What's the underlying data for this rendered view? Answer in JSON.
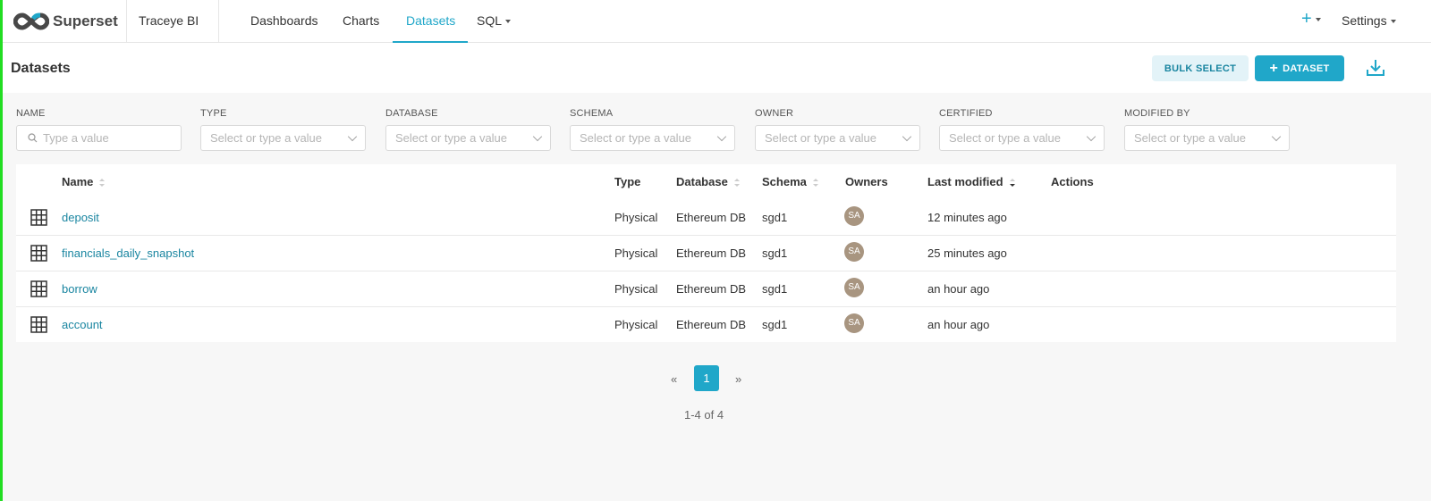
{
  "nav": {
    "logo_text": "Superset",
    "brand": "Traceye BI",
    "items": [
      "Dashboards",
      "Charts",
      "Datasets",
      "SQL"
    ],
    "plus": "+",
    "settings": "Settings"
  },
  "header": {
    "title": "Datasets",
    "bulk_select": "BULK SELECT",
    "add_dataset": "DATASET",
    "add_icon": "+"
  },
  "filters": {
    "name": {
      "label": "NAME",
      "placeholder": "Type a value"
    },
    "type": {
      "label": "TYPE",
      "placeholder": "Select or type a value"
    },
    "database": {
      "label": "DATABASE",
      "placeholder": "Select or type a value"
    },
    "schema": {
      "label": "SCHEMA",
      "placeholder": "Select or type a value"
    },
    "owner": {
      "label": "OWNER",
      "placeholder": "Select or type a value"
    },
    "certified": {
      "label": "CERTIFIED",
      "placeholder": "Select or type a value"
    },
    "modified_by": {
      "label": "MODIFIED BY",
      "placeholder": "Select or type a value"
    }
  },
  "table": {
    "columns": [
      "Name",
      "Type",
      "Database",
      "Schema",
      "Owners",
      "Last modified",
      "Actions"
    ],
    "rows": [
      {
        "name": "deposit",
        "type": "Physical",
        "database": "Ethereum DB",
        "schema": "sgd1",
        "owner": "SA",
        "modified": "12 minutes ago"
      },
      {
        "name": "financials_daily_snapshot",
        "type": "Physical",
        "database": "Ethereum DB",
        "schema": "sgd1",
        "owner": "SA",
        "modified": "25 minutes ago"
      },
      {
        "name": "borrow",
        "type": "Physical",
        "database": "Ethereum DB",
        "schema": "sgd1",
        "owner": "SA",
        "modified": "an hour ago"
      },
      {
        "name": "account",
        "type": "Physical",
        "database": "Ethereum DB",
        "schema": "sgd1",
        "owner": "SA",
        "modified": "an hour ago"
      }
    ]
  },
  "pagination": {
    "prev": "«",
    "current": "1",
    "next": "»",
    "range": "1-4 of 4"
  },
  "colors": {
    "accent": "#20a7c9",
    "link": "#1985a0",
    "avatar": "#a89580"
  }
}
